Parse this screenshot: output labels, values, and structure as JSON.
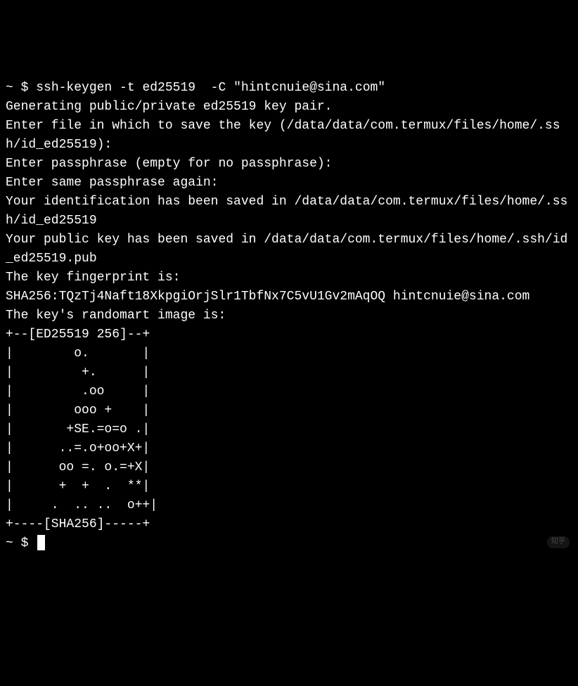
{
  "terminal": {
    "prompt1_prefix": "~ $ ",
    "command": "ssh-keygen -t ed25519  -C \"hintcnuie@sina.com\"",
    "lines": [
      "Generating public/private ed25519 key pair.",
      "Enter file in which to save the key (/data/data/com.termux/files/home/.ssh/id_ed25519):",
      "Enter passphrase (empty for no passphrase):",
      "Enter same passphrase again:",
      "Your identification has been saved in /data/data/com.termux/files/home/.ssh/id_ed25519",
      "Your public key has been saved in /data/data/com.termux/files/home/.ssh/id_ed25519.pub",
      "The key fingerprint is:",
      "SHA256:TQzTj4Naft18XkpgiOrjSlr1TbfNx7C5vU1Gv2mAqOQ hintcnuie@sina.com",
      "The key's randomart image is:",
      "+--[ED25519 256]--+",
      "|        o.       |",
      "|         +.      |",
      "|         .oo     |",
      "|        ooo +    |",
      "|       +SE.=o=o .|",
      "|      ..=.o+oo+X+|",
      "|      oo =. o.=+X|",
      "|      +  +  .  **|",
      "|     .  .. ..  o++|",
      "+----[SHA256]-----+"
    ],
    "prompt2_prefix": "~ $ "
  },
  "watermark": "知乎"
}
